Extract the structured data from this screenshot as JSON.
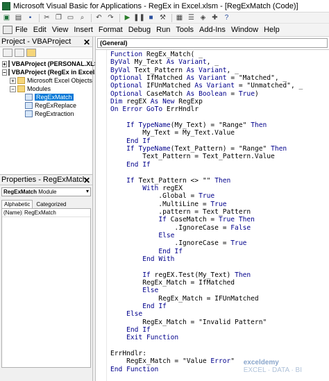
{
  "window": {
    "title": "Microsoft Visual Basic for Applications - RegEx in Excel.xlsm - [RegExMatch (Code)]"
  },
  "toolbar": {
    "icons": [
      "excel-icon",
      "insert-icon",
      "save-icon",
      "cut-icon",
      "copy-icon",
      "paste-icon",
      "find-icon",
      "undo-icon",
      "redo-icon",
      "run-icon",
      "break-icon",
      "reset-icon",
      "design-icon",
      "project-icon",
      "properties-icon",
      "object-browser-icon",
      "toolbox-icon",
      "help-icon"
    ]
  },
  "menubar": {
    "items": [
      "File",
      "Edit",
      "View",
      "Insert",
      "Format",
      "Debug",
      "Run",
      "Tools",
      "Add-Ins",
      "Window",
      "Help"
    ]
  },
  "project_pane": {
    "title": "Project - VBAProject",
    "tree": [
      {
        "label": "VBAProject (PERSONAL.XLS"
      },
      {
        "label": "VBAProject (RegEx in Excel."
      },
      {
        "label": "Microsoft Excel Objects"
      },
      {
        "label": "Modules"
      },
      {
        "label": "RegExMatch"
      },
      {
        "label": "RegExReplace"
      },
      {
        "label": "RegExtraction"
      }
    ]
  },
  "properties_pane": {
    "title": "Properties - RegExMatch",
    "object": "RegExMatch",
    "object_type": "Module",
    "tabs": [
      "Alphabetic",
      "Categorized"
    ],
    "rows": [
      {
        "name": "(Name)",
        "value": "RegExMatch"
      }
    ]
  },
  "code_window": {
    "combo": "(General)",
    "lines": [
      "Function RegEx_Match( _",
      "ByVal My_Text As Variant, _",
      "ByVal Text_Pattern As Variant, _",
      "Optional IfMatched As Variant = \"Matched\", _",
      "Optional IFUnMatched As Variant = \"Unmatched\", _",
      "Optional CaseMatch As Boolean = True)",
      "Dim regEX As New RegExp",
      "On Error GoTo ErrHndlr",
      "",
      "    If TypeName(My_Text) = \"Range\" Then",
      "        My_Text = My_Text.Value",
      "    End If",
      "    If TypeName(Text_Pattern) = \"Range\" Then",
      "        Text_Pattern = Text_Pattern.Value",
      "    End If",
      "",
      "    If Text_Pattern <> \"\" Then",
      "        With regEX",
      "            .Global = True",
      "            .MultiLine = True",
      "            .pattern = Text_Pattern",
      "            If CaseMatch = True Then",
      "                .IgnoreCase = False",
      "            Else",
      "                .IgnoreCase = True",
      "            End If",
      "        End With",
      "",
      "        If regEX.Test(My_Text) Then",
      "        RegEx_Match = IfMatched",
      "        Else",
      "            RegEx_Match = IFUnMatched",
      "        End If",
      "    Else",
      "        RegEx_Match = \"Invalid Pattern\"",
      "    End If",
      "    Exit Function",
      "",
      "ErrHndlr:",
      "    RegEx_Match = \"Value Error\"",
      "End Function"
    ],
    "watermark_brand": "exceldemy",
    "watermark_tag": "EXCEL · DATA · BI"
  }
}
